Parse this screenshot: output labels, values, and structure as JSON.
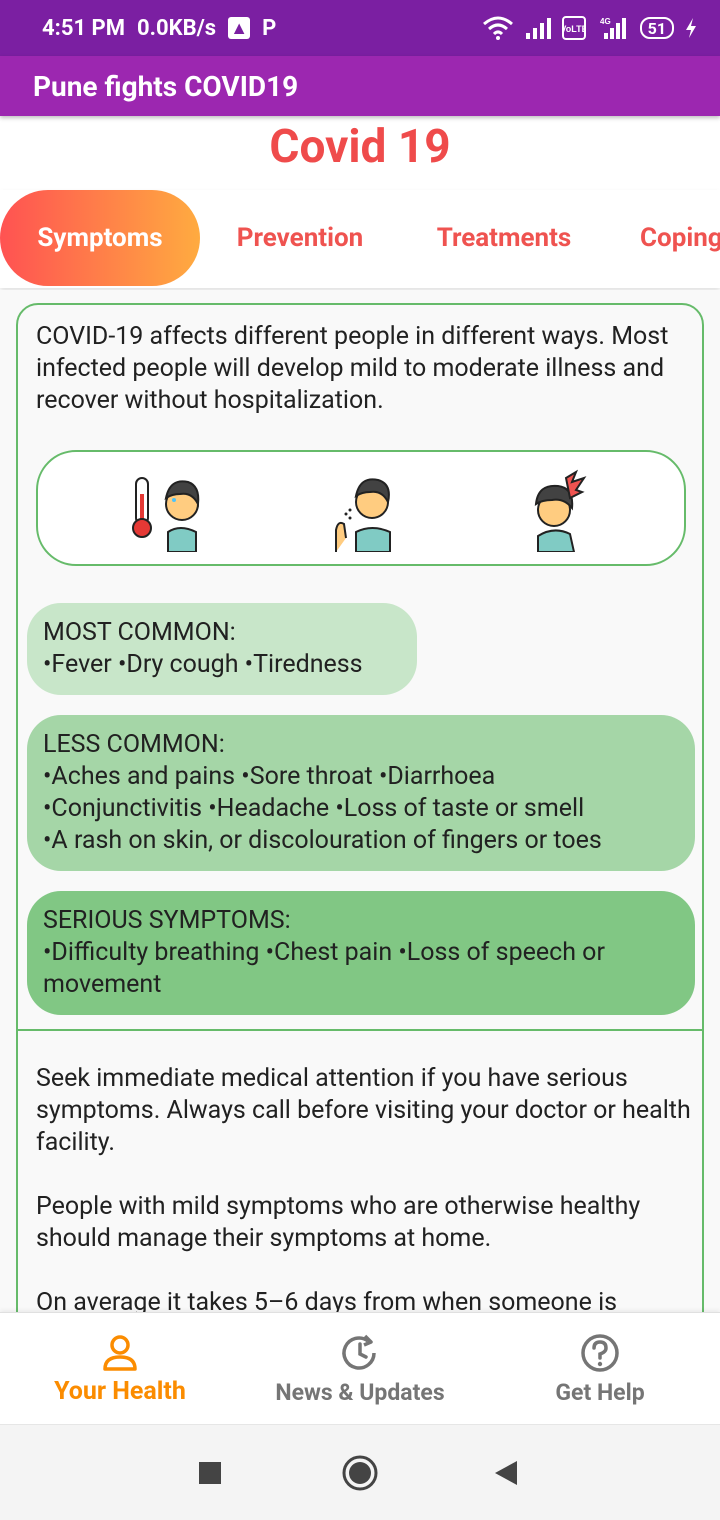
{
  "status_bar": {
    "time": "4:51 PM",
    "speed": "0.0KB/s",
    "upload_icon": "upload-arrow-icon",
    "p_icon": "P",
    "battery": "51"
  },
  "app": {
    "title": "Pune fights COVID19"
  },
  "page": {
    "title": "Covid 19"
  },
  "tabs": [
    {
      "label": "Symptoms",
      "active": true
    },
    {
      "label": "Prevention",
      "active": false
    },
    {
      "label": "Treatments",
      "active": false
    },
    {
      "label": "Coping",
      "active": false
    }
  ],
  "card": {
    "intro": "COVID-19 affects different people in different ways. Most infected people will develop mild to moderate illness and recover without hospitalization.",
    "icons": [
      "fever-thermometer-icon",
      "cough-icon",
      "headache-icon"
    ],
    "most_common": {
      "heading": "MOST COMMON:",
      "items": "•Fever •Dry cough •Tiredness"
    },
    "less_common": {
      "heading": "LESS COMMON:",
      "line1": "•Aches and pains •Sore throat •Diarrhoea",
      "line2": "•Conjunctivitis •Headache •Loss of taste or smell",
      "line3": "•A rash on skin, or discolouration of fingers or toes"
    },
    "serious": {
      "heading": "SERIOUS SYMPTOMS:",
      "items": "•Difficulty breathing •Chest pain •Loss of speech or movement"
    },
    "para1": "Seek immediate medical attention if you have serious symptoms. Always call before visiting your doctor or health facility.",
    "para2": "People with mild symptoms who are otherwise healthy should manage their symptoms at home.",
    "para3": "On average it takes 5–6 days from when someone is"
  },
  "bottom_nav": [
    {
      "label": "Your Health",
      "icon": "person-icon",
      "active": true
    },
    {
      "label": "News & Updates",
      "icon": "history-icon",
      "active": false
    },
    {
      "label": "Get Help",
      "icon": "help-circle-icon",
      "active": false
    }
  ],
  "colors": {
    "status_bar": "#7b1fa2",
    "app_bar": "#9c27b0",
    "accent_red": "#ef4b4b",
    "active_nav": "#fb8c00",
    "green_border": "#66bb6a"
  }
}
